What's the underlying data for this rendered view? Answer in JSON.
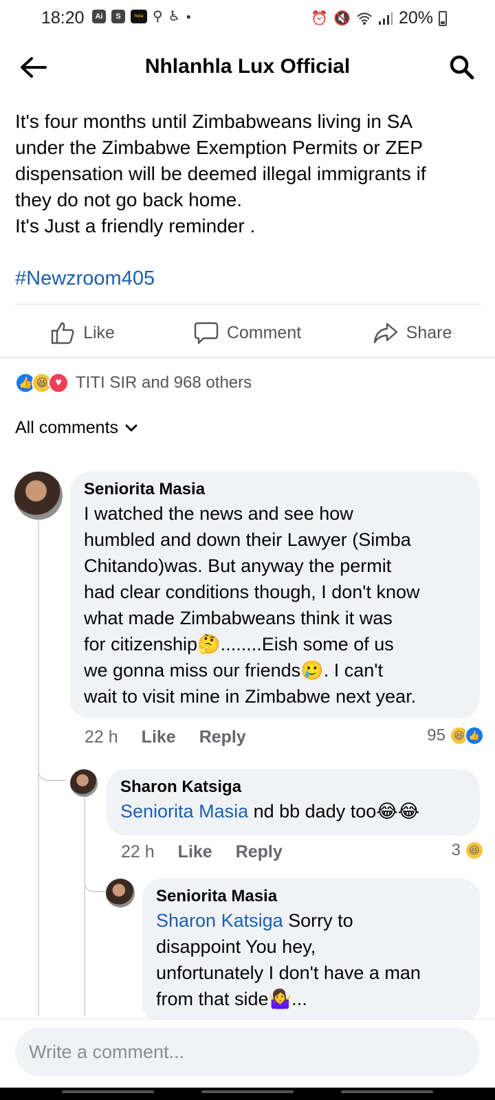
{
  "status_bar": {
    "time": "18:20",
    "app_icons": [
      "Ai",
      "S",
      "hola"
    ],
    "battery": "20%"
  },
  "header": {
    "title": "Nhlanhla Lux Official"
  },
  "post": {
    "text": "It's four months until Zimbabweans living in SA\nunder the Zimbabwe Exemption Permits or ZEP\ndispensation will be deemed illegal immigrants if\nthey do not go back home.\nIt's Just a friendly reminder .",
    "hashtag": "#Newzroom405",
    "actions": {
      "like": "Like",
      "comment": "Comment",
      "share": "Share"
    },
    "reactions_summary": "TITI SIR and 968 others"
  },
  "comments_filter": "All comments",
  "comments": [
    {
      "author": "Seniorita Masia",
      "text_lines": "I watched the news and see how\nhumbled and down their Lawyer (Simba\nChitando)was. But anyway the permit\nhad clear conditions though, I don't know\nwhat made Zimbabweans think it was\nfor citizenship🤔........Eish some of us\nwe gonna miss our friends🥲. I can't\nwait to visit mine in Zimbabwe next year.",
      "time": "22 h",
      "like": "Like",
      "reply": "Reply",
      "reaction_count": "95"
    },
    {
      "author": "Sharon Katsiga",
      "mention": "Seniorita Masia",
      "text": " nd bb dady too😂😂",
      "time": "22 h",
      "like": "Like",
      "reply": "Reply",
      "reaction_count": "3"
    },
    {
      "author": "Seniorita Masia",
      "mention": "Sharon Katsiga",
      "text": " Sorry to\ndisappoint You hey,\nunfortunately I don't have a man\nfrom that side🤷‍♀️..."
    }
  ],
  "composer": {
    "placeholder": "Write a comment..."
  },
  "colors": {
    "link": "#1b5fb0",
    "bubble": "#f0f2f5",
    "muted": "#65676b"
  }
}
